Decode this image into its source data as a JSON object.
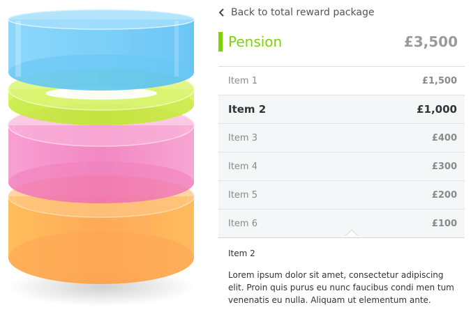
{
  "back_link": {
    "label": "Back to total reward package",
    "icon": "chevron-left-icon"
  },
  "section": {
    "title": "Pension",
    "total": "£3,500",
    "accent_color": "#7fd10b"
  },
  "items": [
    {
      "name": "Item 1",
      "amount": "£1,500"
    },
    {
      "name": "Item 2",
      "amount": "£1,000"
    },
    {
      "name": "Item 3",
      "amount": "£400"
    },
    {
      "name": "Item 4",
      "amount": "£300"
    },
    {
      "name": "Item 5",
      "amount": "£200"
    },
    {
      "name": "Item 6",
      "amount": "£100"
    }
  ],
  "selected_index": 1,
  "detail": {
    "title": "Item 2",
    "text": "Lorem ipsum dolor sit amet, consectetur adipiscing elit. Proin quis purus eu nunc faucibus condi men tum venenatis eu nulla. Aliquam ut elementum ante."
  },
  "layers": [
    {
      "name": "blue-layer",
      "color": "#5cc6f8"
    },
    {
      "name": "green-layer",
      "color": "#c6ee3a"
    },
    {
      "name": "pink-layer",
      "color": "#f47fc1"
    },
    {
      "name": "orange-layer",
      "color": "#ffa84a"
    }
  ]
}
